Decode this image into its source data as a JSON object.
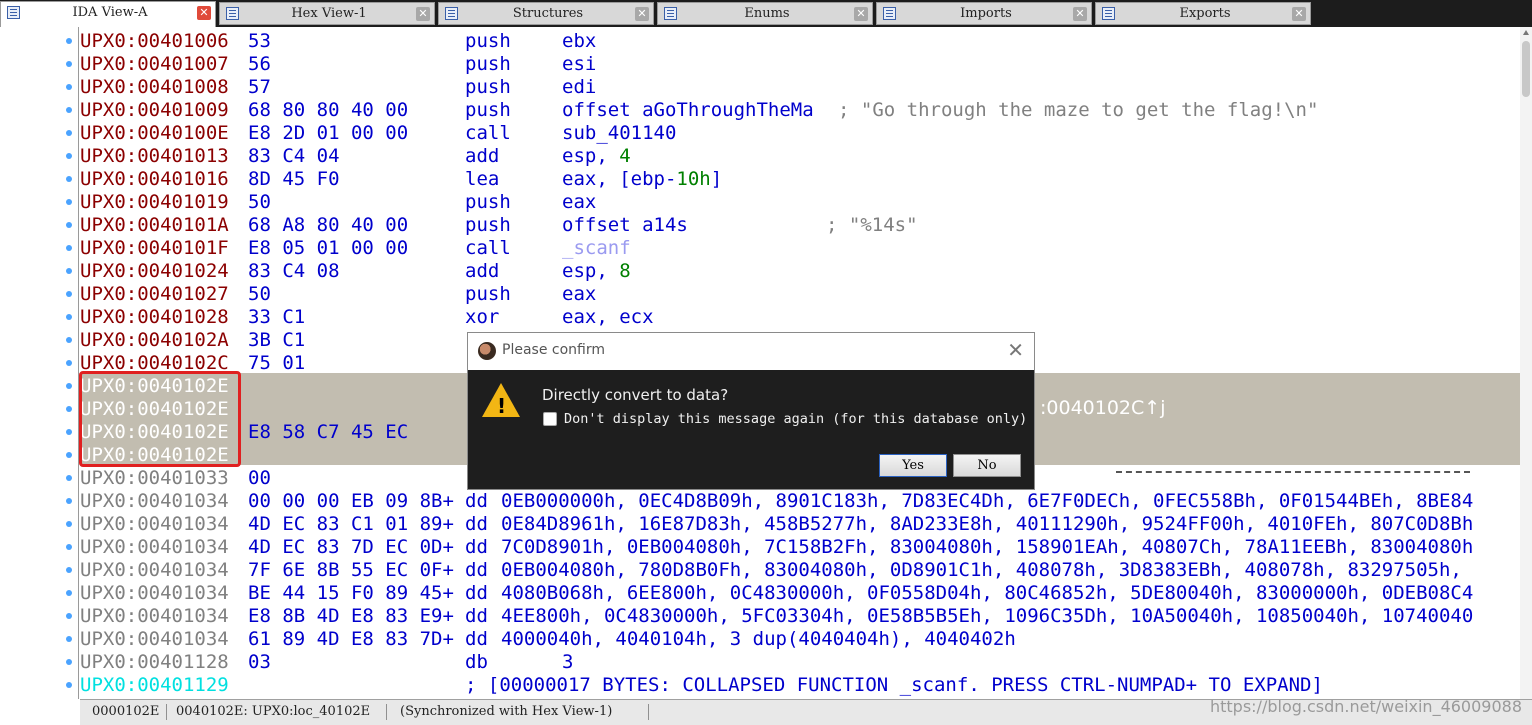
{
  "tabs": [
    {
      "label": "IDA View-A",
      "active": true
    },
    {
      "label": "Hex View-1",
      "active": false
    },
    {
      "label": "Structures",
      "active": false
    },
    {
      "label": "Enums",
      "active": false
    },
    {
      "label": "Imports",
      "active": false
    },
    {
      "label": "Exports",
      "active": false
    }
  ],
  "lines": [
    {
      "addr": "UPX0:00401006",
      "bytes": "53",
      "mn": "push",
      "op": "ebx"
    },
    {
      "addr": "UPX0:00401007",
      "bytes": "56",
      "mn": "push",
      "op": "esi"
    },
    {
      "addr": "UPX0:00401008",
      "bytes": "57",
      "mn": "push",
      "op": "edi"
    },
    {
      "addr": "UPX0:00401009",
      "bytes": "68 80 80 40 00",
      "mn": "push",
      "op": "offset aGoThroughTheMa",
      "cmt": "; \"Go through the maze to get the flag!\\n\""
    },
    {
      "addr": "UPX0:0040100E",
      "bytes": "E8 2D 01 00 00",
      "mn": "call",
      "op": "sub_401140"
    },
    {
      "addr": "UPX0:00401013",
      "bytes": "83 C4 04",
      "mn": "add",
      "op": "esp,",
      "num": "4"
    },
    {
      "addr": "UPX0:00401016",
      "bytes": "8D 45 F0",
      "mn": "lea",
      "op": "eax, [ebp-",
      "num": "10h",
      "op2": "]"
    },
    {
      "addr": "UPX0:00401019",
      "bytes": "50",
      "mn": "push",
      "op": "eax"
    },
    {
      "addr": "UPX0:0040101A",
      "bytes": "68 A8 80 40 00",
      "mn": "push",
      "op": "offset a14s",
      "cmt": "; \"%14s\""
    },
    {
      "addr": "UPX0:0040101F",
      "bytes": "E8 05 01 00 00",
      "mn": "call",
      "func": "_scanf"
    },
    {
      "addr": "UPX0:00401024",
      "bytes": "83 C4 08",
      "mn": "add",
      "op": "esp,",
      "num": "8"
    },
    {
      "addr": "UPX0:00401027",
      "bytes": "50",
      "mn": "push",
      "op": "eax"
    },
    {
      "addr": "UPX0:00401028",
      "bytes": "33 C1",
      "mn": "xor",
      "op": "eax, ecx"
    },
    {
      "addr": "UPX0:0040102A",
      "bytes": "3B C1",
      "mn": "",
      "op": ""
    },
    {
      "addr": "UPX0:0040102C",
      "bytes": "75 01",
      "mn": "",
      "op": ""
    },
    {
      "addr": "UPX0:0040102E",
      "bytes": "",
      "mn": "",
      "op": ""
    },
    {
      "addr": "UPX0:0040102E",
      "bytes": "",
      "mn": "",
      "op": ""
    },
    {
      "addr": "UPX0:0040102E",
      "bytes": "E8 58 C7 45 EC",
      "mn": "",
      "op": ""
    },
    {
      "addr": "UPX0:0040102E",
      "bytes": "",
      "mn": "",
      "op": ""
    },
    {
      "addr": "UPX0:00401033",
      "bytes": "00",
      "mn": "",
      "op": ""
    },
    {
      "addr": "UPX0:00401034",
      "bytes": "00 00 00 EB 09 8B+",
      "mn": "dd",
      "op": "0EB000000h, 0EC4D8B09h, 8901C183h, 7D83EC4Dh, 6E7F0DECh, 0FEC558Bh, 0F01544BEh, 8BE84"
    },
    {
      "addr": "UPX0:00401034",
      "bytes": "4D EC 83 C1 01 89+",
      "mn": "dd",
      "op": "0E84D8961h, 16E87D83h, 458B5277h, 8AD233E8h, 40111290h, 9524FF00h, 4010FEh, 807C0D8Bh"
    },
    {
      "addr": "UPX0:00401034",
      "bytes": "4D EC 83 7D EC 0D+",
      "mn": "dd",
      "op": "7C0D8901h, 0EB004080h, 7C158B2Fh, 83004080h, 158901EAh, 40807Ch, 78A11EEBh, 83004080h"
    },
    {
      "addr": "UPX0:00401034",
      "bytes": "7F 6E 8B 55 EC 0F+",
      "mn": "dd",
      "op": "0EB004080h, 780D8B0Fh, 83004080h, 0D8901C1h, 408078h, 3D8383EBh, 408078h, 83297505h,"
    },
    {
      "addr": "UPX0:00401034",
      "bytes": "BE 44 15 F0 89 45+",
      "mn": "dd",
      "op": "4080B068h, 6EE800h, 0C4830000h, 0F0558D04h, 80C46852h, 5DE80040h, 83000000h, 0DEB08C4"
    },
    {
      "addr": "UPX0:00401034",
      "bytes": "E8 8B 4D E8 83 E9+",
      "mn": "dd",
      "op": "4EE800h, 0C4830000h, 5FC03304h, 0E58B5B5Eh, 1096C35Dh, 10A50040h, 10850040h, 10740040"
    },
    {
      "addr": "UPX0:00401034",
      "bytes": "61 89 4D E8 83 7D+",
      "mn": "dd",
      "op": "4000040h, 4040104h, 3 dup(4040404h), 4040402h"
    },
    {
      "addr": "UPX0:00401128",
      "bytes": "03",
      "mn": "db",
      "op": "3"
    },
    {
      "addr": "UPX0:00401129",
      "bytes": "",
      "mn": "",
      "op": "",
      "coll": "; [00000017 BYTES: COLLAPSED FUNCTION _scanf. PRESS CTRL-NUMPAD+ TO EXPAND]"
    }
  ],
  "highlight_tail": ":0040102C↑j",
  "dialog": {
    "title": "Please confirm",
    "question": "Directly convert to data?",
    "checkbox_label": "Don't display this message again (for this database only)",
    "checkbox_checked": false,
    "yes_label": "Yes",
    "no_label": "No"
  },
  "status": {
    "offset": "0000102E",
    "location": "0040102E: UPX0:loc_40102E",
    "sync": "(Synchronized with Hex View-1)",
    "watermark": "https://blog.csdn.net/weixin_46009088"
  },
  "colors": {
    "address_seg": "#8b0000",
    "address_data": "#808080",
    "address_collapsed": "#00e0e0",
    "code": "#0000cc",
    "number": "#008000",
    "comment": "#808080",
    "highlight_bg": "#c2bdb0",
    "selection_box": "#e02020",
    "dialog_bg": "#1e1e1e",
    "warning": "#f2b614"
  },
  "icons": {
    "tab_close": "close-icon",
    "dialog_close": "close-icon",
    "dialog_warning": "warning-triangle-icon"
  }
}
